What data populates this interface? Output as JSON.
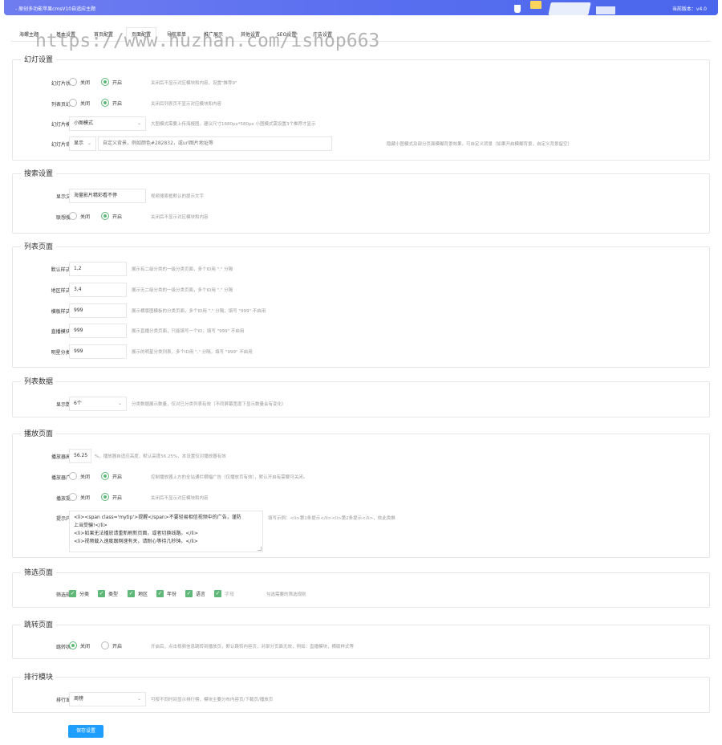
{
  "header": {
    "title": "- 原创多功能苹果cmsV10自适应主题",
    "version": "当前版本：v4.0"
  },
  "tabs": [
    "海螺主题",
    "基本设置",
    "首页配置",
    "页面配置",
    "导航菜单",
    "推广展示",
    "其他设置",
    "SEO设置",
    "广告设置"
  ],
  "active_tab": "页面配置",
  "watermark": "https://www.huzhan.com/ishop663",
  "slide": {
    "legend": "幻灯设置",
    "status_label": "幻灯片状态",
    "status_off": "关闭",
    "status_on": "开启",
    "status_hint": "关闭后不显示对应模块和内容，设置\"推荐9\"",
    "list_label": "列表页幻灯",
    "list_off": "关闭",
    "list_on": "开启",
    "list_hint": "关闭后列表页不显示对应模块和内容",
    "mode_label": "幻灯片模式",
    "mode_value": "小图模式",
    "mode_hint": "大图模式需要上传海报图，建议尺寸1680px*580px 小图模式需设置3个推荐才显示",
    "bg_label": "幻灯片背景",
    "bg_select": "显示",
    "bg_placeholder": "自定义背景，例如颜色#282832，或url图片地址等",
    "bg_hint": "隐藏小图模式及部分页面模糊背景效果，可自定义背景（如果开启模糊背景，自定义背景留空）"
  },
  "search": {
    "legend": "搜索设置",
    "text_label": "显示文字",
    "text_value": "海量影片精彩看不停",
    "text_hint": "视频搜索框默认的提示文字",
    "assoc_label": "联想搜索",
    "assoc_off": "关闭",
    "assoc_on": "开启",
    "assoc_hint": "关闭后不显示对应模块和内容"
  },
  "listpage": {
    "legend": "列表页面",
    "rows": [
      {
        "label": "默认样式ID",
        "value": "1,2",
        "hint": "展示有二级分类的一级分类页面，多个ID用 \",\" 分隔"
      },
      {
        "label": "地区样式ID",
        "value": "3,4",
        "hint": "展示无二级分类的一级分类页面，多个ID用 \",\" 分隔"
      },
      {
        "label": "横板样式ID",
        "value": "999",
        "hint": "展示横版图模板的分类页面，多个ID用 \",\" 分隔，填写 \"999\" 不启用"
      },
      {
        "label": "直播模块ID",
        "value": "999",
        "hint": "展示直播分类页面，只能填写一个ID，填写 \"999\" 不启用"
      },
      {
        "label": "明星分类ID",
        "value": "999",
        "hint": "展示的明星分类列表，多个ID用 \",\" 分隔，填写 \"999\" 不启用"
      }
    ]
  },
  "listdata": {
    "legend": "列表数据",
    "count_label": "显示数量",
    "count_value": "6个",
    "count_hint": "分类数据展示数量，仅对已分类列表有效（不同屏幕宽度下显示数量会有变化）"
  },
  "play": {
    "legend": "播放页面",
    "height_label": "播放器高度",
    "height_value": "56.25",
    "height_hint": "%，播放器自适应高度，默认高度56.25%，本设置仅对播放器有效",
    "ad_label": "播放器广告",
    "ad_off": "关闭",
    "ad_on": "开启",
    "ad_hint": "控制播放器上方的全站通栏横幅广告（仅播放页有效），默认开启有需要可关闭。",
    "tip_label": "播放提示",
    "tip_off": "关闭",
    "tip_on": "开启",
    "tip_hint": "关闭后不显示对应模块和内容",
    "content_label": "提示内容",
    "content_lines": [
      "<li><span class='mytip'>提醒</span>不要轻易相信视频中的广告，谨防",
      "上当受骗!</li>",
      "<li>如果无法播放请重新刷新页面，或者切换线路。</li>",
      "<li>视频载入速度跟网速有关，请耐心等待几秒钟。</li>"
    ],
    "content_hint": "填写示例：<li>第1条提示</li><li>第2条提示</li>，依此类推"
  },
  "filter": {
    "legend": "筛选页面",
    "label": "筛选规则",
    "items": [
      {
        "text": "分类",
        "checked": true
      },
      {
        "text": "类型",
        "checked": true
      },
      {
        "text": "地区",
        "checked": true
      },
      {
        "text": "年份",
        "checked": true
      },
      {
        "text": "语言",
        "checked": true
      },
      {
        "text": "字母",
        "checked": true
      }
    ],
    "hint": "勾选需要的筛选规则"
  },
  "jump": {
    "legend": "跳转页面",
    "label": "跳转状态",
    "off": "关闭",
    "on": "开启",
    "hint": "开启后，点击视频信息跳转到播放页，默认跳转内容页，对部分页面无效，例如：直播模块，横版样式等"
  },
  "rank": {
    "legend": "排行模块",
    "label": "排行显示",
    "value": "周榜",
    "hint": "可按不同时间显示排行榜，模块主要分布内容页/下载页/播放页"
  },
  "save_label": "保存设置",
  "colors": {
    "accent": "#5fb878",
    "button": "#1e9fff",
    "header": "#5a6ff0"
  }
}
